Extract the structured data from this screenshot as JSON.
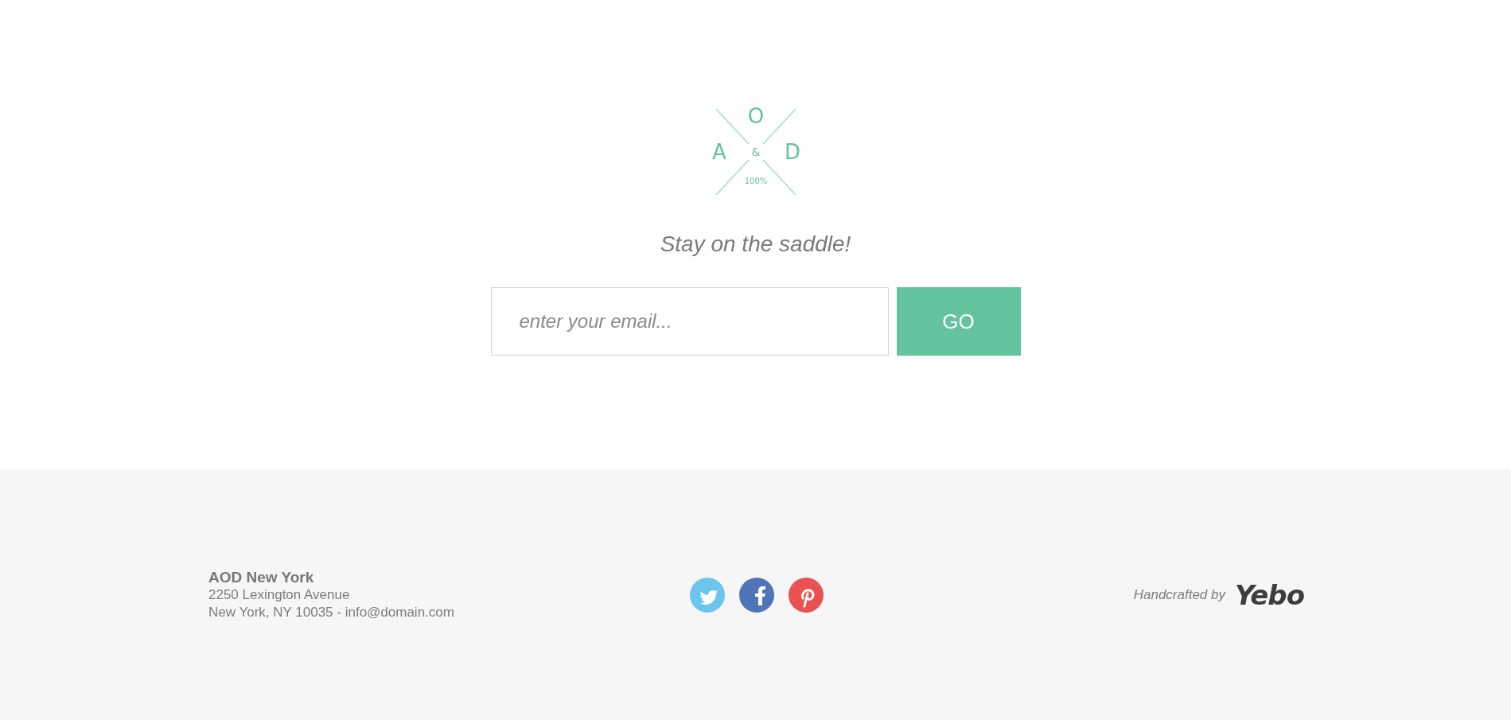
{
  "logo": {
    "top": "O",
    "left": "A",
    "center": "&",
    "right": "D",
    "caption": "100%"
  },
  "tagline": "Stay on the saddle!",
  "subscribe": {
    "placeholder": "enter your email...",
    "button": "GO"
  },
  "footer": {
    "company": "AOD New York",
    "address": "2250 Lexington Avenue",
    "contact": "New York, NY 10035 - info@domain.com",
    "socials": [
      {
        "kind": "twitter",
        "color": "#6cc5ec"
      },
      {
        "kind": "facebook",
        "color": "#4f74b8"
      },
      {
        "kind": "pinterest",
        "color": "#ea5252"
      }
    ],
    "credit": "Handcrafted by",
    "credit_logo": "Yebo"
  }
}
